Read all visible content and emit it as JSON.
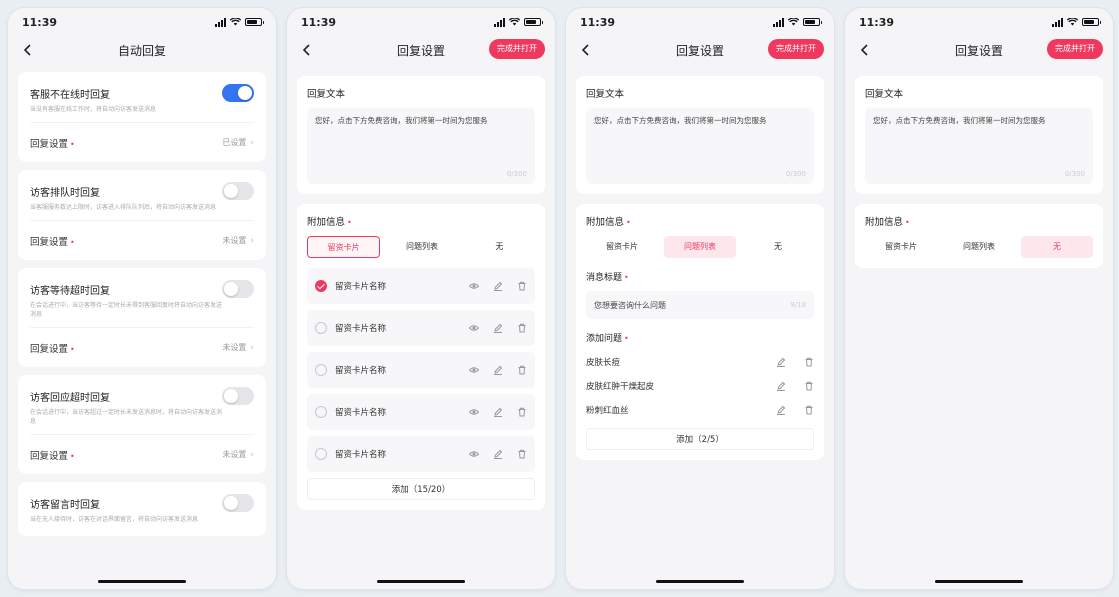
{
  "status": {
    "time": "11:39"
  },
  "screen1": {
    "title": "自动回复",
    "sections": [
      {
        "title": "客服不在线时回复",
        "desc": "当没有客服在线工作时，将自动向访客发送消息",
        "toggle_on": true,
        "row_label": "回复设置",
        "row_value": "已设置"
      },
      {
        "title": "访客排队时回复",
        "desc": "当客服服务数达上限时，访客进入排队队列后，将自动向访客发送消息",
        "toggle_on": false,
        "row_label": "回复设置",
        "row_value": "未设置"
      },
      {
        "title": "访客等待超时回复",
        "desc": "在会话进行中，当访客等待一定时长未得到客服回复时将自动向访客发送消息",
        "toggle_on": false,
        "row_label": "回复设置",
        "row_value": "未设置"
      },
      {
        "title": "访客回应超时回复",
        "desc": "在会话进行中，当访客超过一定时长未发送消息时，将自动向访客发送消息",
        "toggle_on": false,
        "row_label": "回复设置",
        "row_value": "未设置"
      },
      {
        "title": "访客留言时回复",
        "desc": "当在无人接待时，访客在对话界面留言，将自动向访客发送消息",
        "toggle_on": false
      }
    ]
  },
  "settings": {
    "title": "回复设置",
    "done_button": "完成并打开",
    "reply_text_label": "回复文本",
    "reply_text": "您好，点击下方免费咨询，我们将第一时间为您服务",
    "reply_count": "0/300",
    "extra_label": "附加信息",
    "options": [
      "留资卡片",
      "问题列表",
      "无"
    ]
  },
  "screen2": {
    "cards": [
      {
        "name": "留资卡片名称",
        "checked": true
      },
      {
        "name": "留资卡片名称",
        "checked": false
      },
      {
        "name": "留资卡片名称",
        "checked": false
      },
      {
        "name": "留资卡片名称",
        "checked": false
      },
      {
        "name": "留资卡片名称",
        "checked": false
      }
    ],
    "add_label": "添加（15/20）"
  },
  "screen3": {
    "msg_title_label": "消息标题",
    "msg_title_value": "您想要咨询什么问题",
    "msg_title_count": "9/18",
    "add_questions_label": "添加问题",
    "questions": [
      "皮肤长痘",
      "皮肤红肿干燥起皮",
      "粉刺红血丝"
    ],
    "add_label": "添加（2/5）"
  },
  "icons": {
    "eye": "eye-icon",
    "edit": "pencil-icon",
    "delete": "trash-icon",
    "back": "chevron-left-icon",
    "forward": "chevron-right-icon"
  },
  "colors": {
    "accent": "#f0385e",
    "toggle_on": "#3574f0"
  }
}
